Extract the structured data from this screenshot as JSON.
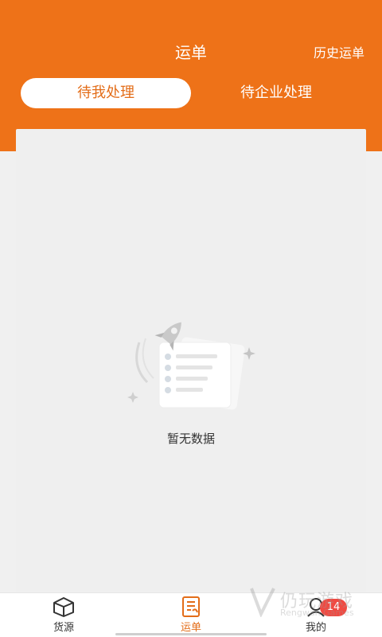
{
  "header": {
    "title": "运单",
    "history_link": "历史运单",
    "tabs": [
      {
        "label": "待我处理",
        "active": true
      },
      {
        "label": "待企业处理",
        "active": false
      }
    ]
  },
  "content": {
    "empty_text": "暂无数据",
    "empty_icon": "rocket-document-icon"
  },
  "tabbar": {
    "items": [
      {
        "label": "货源",
        "icon": "box-icon",
        "active": false
      },
      {
        "label": "运单",
        "icon": "waybill-icon",
        "active": true
      },
      {
        "label": "我的",
        "icon": "profile-icon",
        "active": false,
        "badge": "14"
      }
    ]
  },
  "watermark": {
    "text": "仍玩游戏",
    "sub": "Rengwan Games"
  },
  "colors": {
    "brand": "#ee7218",
    "accent_text": "#e36d19",
    "badge": "#f04a42",
    "background": "#f0f0f0"
  }
}
